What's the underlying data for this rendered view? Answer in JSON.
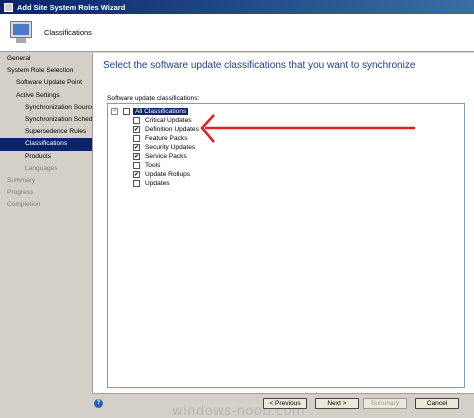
{
  "window": {
    "title": "Add Site System Roles Wizard"
  },
  "header": {
    "title": "Classifications"
  },
  "sidebar": {
    "items": [
      {
        "label": "General",
        "indent": 0,
        "state": "normal"
      },
      {
        "label": "System Role Selection",
        "indent": 0,
        "state": "normal"
      },
      {
        "label": "Software Update Point",
        "indent": 1,
        "state": "normal"
      },
      {
        "label": "Active Settings",
        "indent": 1,
        "state": "normal"
      },
      {
        "label": "Synchronization Source",
        "indent": 2,
        "state": "normal"
      },
      {
        "label": "Synchronization Schedule",
        "indent": 2,
        "state": "normal"
      },
      {
        "label": "Supersedence Rules",
        "indent": 2,
        "state": "normal"
      },
      {
        "label": "Classifications",
        "indent": 2,
        "state": "selected"
      },
      {
        "label": "Products",
        "indent": 2,
        "state": "normal"
      },
      {
        "label": "Languages",
        "indent": 2,
        "state": "dim"
      },
      {
        "label": "Summary",
        "indent": 0,
        "state": "dim"
      },
      {
        "label": "Progress",
        "indent": 0,
        "state": "dim"
      },
      {
        "label": "Completion",
        "indent": 0,
        "state": "dim"
      }
    ]
  },
  "main": {
    "title": "Select the software update classifications that you want to synchronize",
    "list_label": "Software update classifications:",
    "root": {
      "label": "All Classifications",
      "checked": false
    },
    "items": [
      {
        "label": "Critical Updates",
        "checked": false
      },
      {
        "label": "Definition Updates",
        "checked": true
      },
      {
        "label": "Feature Packs",
        "checked": false
      },
      {
        "label": "Security Updates",
        "checked": true
      },
      {
        "label": "Service Packs",
        "checked": true
      },
      {
        "label": "Tools",
        "checked": false
      },
      {
        "label": "Update Rollups",
        "checked": true
      },
      {
        "label": "Updates",
        "checked": false
      }
    ]
  },
  "footer": {
    "help": "?",
    "previous": "< Previous",
    "next": "Next >",
    "summary": "Summary",
    "cancel": "Cancel",
    "watermark": "windows-noob.com"
  },
  "colors": {
    "annotation_arrow": "#e02020",
    "selection": "#0a246a"
  },
  "icons": {
    "header": "computer-monitor-icon",
    "help": "help-icon"
  }
}
